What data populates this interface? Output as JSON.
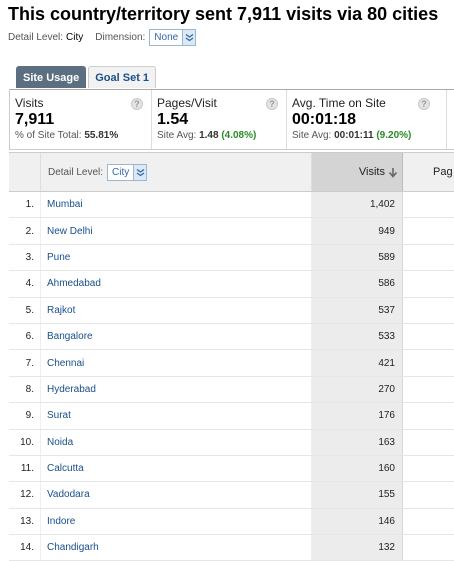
{
  "header": {
    "title": "This country/territory sent 7,911 visits via 80 cities",
    "detail_level_label": "Detail Level:",
    "detail_level_value": "City",
    "dimension_label": "Dimension:",
    "dimension_value": "None"
  },
  "tabs": [
    {
      "label": "Site Usage",
      "active": true
    },
    {
      "label": "Goal Set 1",
      "active": false
    }
  ],
  "summary": {
    "visits": {
      "name": "Visits",
      "value": "7,911",
      "sub_label": "% of Site Total:",
      "sub_value": "55.81%"
    },
    "pages_visit": {
      "name": "Pages/Visit",
      "value": "1.54",
      "sub_label": "Site Avg:",
      "sub_value": "1.48",
      "sub_pct": "(4.08%)"
    },
    "avg_time": {
      "name": "Avg. Time on Site",
      "value": "00:01:18",
      "sub_label": "Site Avg:",
      "sub_value": "00:01:11",
      "sub_pct": "(9.20%)"
    },
    "help_glyph": "?"
  },
  "table": {
    "detail_level_label": "Detail Level:",
    "detail_level_value": "City",
    "visits_header": "Visits",
    "pages_header": "Pag",
    "rows": [
      {
        "num": "1.",
        "city": "Mumbai",
        "visits": "1,402"
      },
      {
        "num": "2.",
        "city": "New Delhi",
        "visits": "949"
      },
      {
        "num": "3.",
        "city": "Pune",
        "visits": "589"
      },
      {
        "num": "4.",
        "city": "Ahmedabad",
        "visits": "586"
      },
      {
        "num": "5.",
        "city": "Rajkot",
        "visits": "537"
      },
      {
        "num": "6.",
        "city": "Bangalore",
        "visits": "533"
      },
      {
        "num": "7.",
        "city": "Chennai",
        "visits": "421"
      },
      {
        "num": "8.",
        "city": "Hyderabad",
        "visits": "270"
      },
      {
        "num": "9.",
        "city": "Surat",
        "visits": "176"
      },
      {
        "num": "10.",
        "city": "Noida",
        "visits": "163"
      },
      {
        "num": "11.",
        "city": "Calcutta",
        "visits": "160"
      },
      {
        "num": "12.",
        "city": "Vadodara",
        "visits": "155"
      },
      {
        "num": "13.",
        "city": "Indore",
        "visits": "146"
      },
      {
        "num": "14.",
        "city": "Chandigarh",
        "visits": "132"
      }
    ]
  },
  "colors": {
    "link": "#1a4f8a",
    "positive": "#2a8a2a",
    "active_tab": "#5b6f80"
  }
}
